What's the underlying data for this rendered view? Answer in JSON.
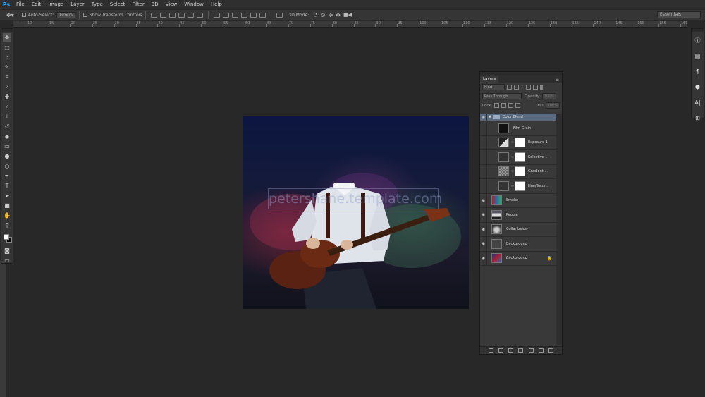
{
  "app": {
    "logo": "Ps"
  },
  "menu": [
    "File",
    "Edit",
    "Image",
    "Layer",
    "Type",
    "Select",
    "Filter",
    "3D",
    "View",
    "Window",
    "Help"
  ],
  "options": {
    "auto_select_label": "Auto-Select:",
    "auto_select_value": "Group",
    "transform_label": "Show Transform Controls",
    "mode_3d_label": "3D Mode:",
    "workspace": "Essentials"
  },
  "ruler": [
    "10",
    "15",
    "20",
    "25",
    "30",
    "35",
    "40",
    "45",
    "50",
    "55",
    "60",
    "65",
    "70",
    "75",
    "80",
    "85",
    "90",
    "95",
    "100",
    "105",
    "110",
    "115",
    "120",
    "125",
    "130",
    "135",
    "140",
    "145",
    "150",
    "155",
    "160"
  ],
  "tools": [
    "move-tool",
    "marquee-tool",
    "lasso-tool",
    "quick-select-tool",
    "crop-tool",
    "eyedropper-tool",
    "healing-brush-tool",
    "brush-tool",
    "clone-stamp-tool",
    "history-brush-tool",
    "eraser-tool",
    "gradient-tool",
    "blur-tool",
    "dodge-tool",
    "pen-tool",
    "type-tool",
    "path-select-tool",
    "shape-tool",
    "hand-tool",
    "zoom-tool"
  ],
  "canvas": {
    "watermark": "petershane.template.com"
  },
  "layers": {
    "tab": "Layers",
    "filter_kind": "Kind",
    "blend_mode": "Pass Through",
    "opacity_label": "Opacity:",
    "opacity_value": "100%",
    "lock_label": "Lock:",
    "fill_label": "Fill:",
    "fill_value": "100%",
    "items": [
      {
        "name": "Color Blend",
        "type": "group"
      },
      {
        "name": "Film Grain",
        "type": "pixel"
      },
      {
        "name": "Exposure 1",
        "type": "adjustment"
      },
      {
        "name": "Selective ...",
        "type": "adjustment"
      },
      {
        "name": "Gradient ...",
        "type": "adjustment"
      },
      {
        "name": "Hue/Satur...",
        "type": "adjustment"
      },
      {
        "name": "Smoke",
        "type": "pixel"
      },
      {
        "name": "People",
        "type": "pixel"
      },
      {
        "name": "Collar below",
        "type": "pixel"
      },
      {
        "name": "Background",
        "type": "pixel"
      },
      {
        "name": "Background",
        "type": "locked"
      }
    ]
  },
  "colors": {
    "accent": "#31a8ff",
    "selected_layer": "#5a6a80",
    "panel": "#393939",
    "workspace": "#282828"
  }
}
